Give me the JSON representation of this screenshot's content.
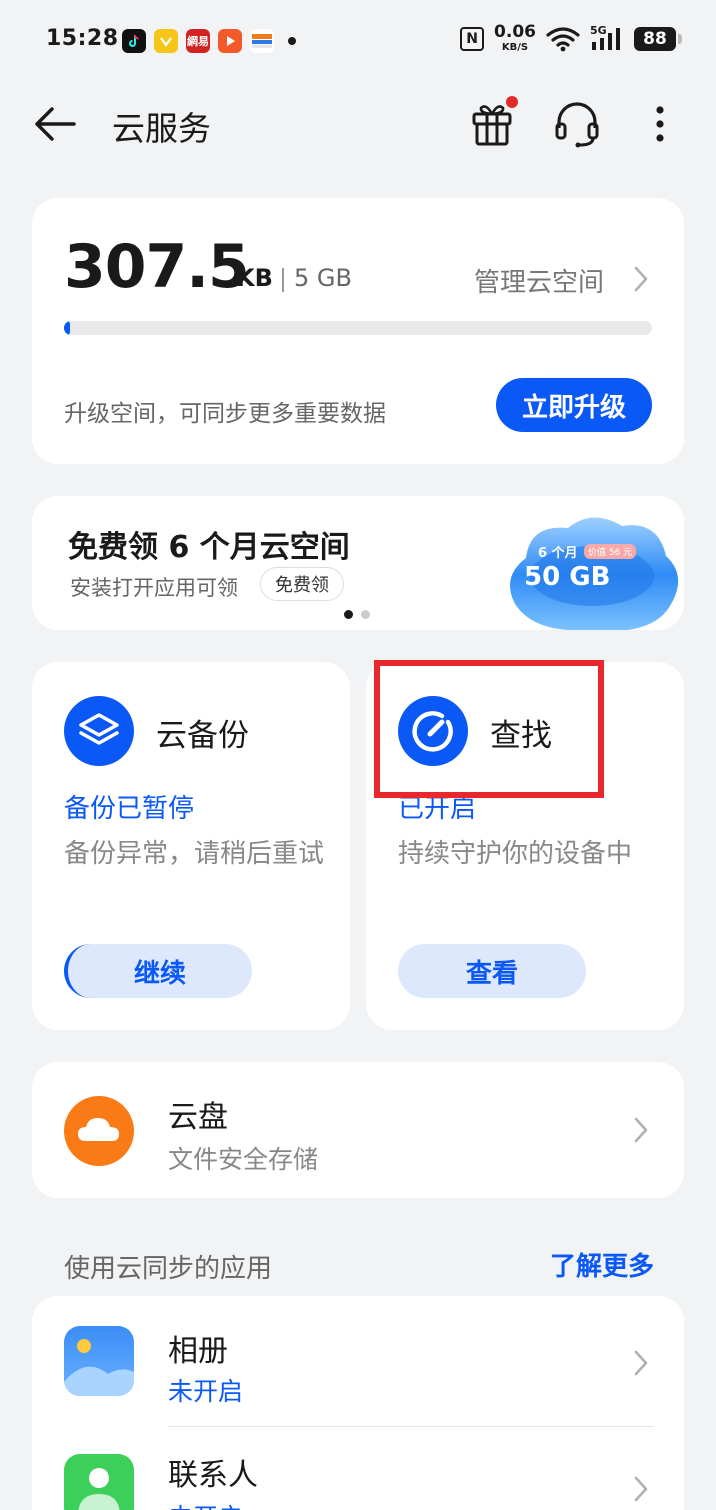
{
  "status_bar": {
    "time": "15:28",
    "app_icons": [
      "tiktok-icon",
      "lemon-icon",
      "netease-icon",
      "video-icon",
      "wallet-icon"
    ],
    "netease_label": "網易",
    "nfc_label": "N",
    "net_speed_value": "0.06",
    "net_speed_unit": "KB/S",
    "network_type": "5G",
    "battery_level": "88"
  },
  "header": {
    "title": "云服务"
  },
  "storage": {
    "used_value": "307.5",
    "used_unit": "KB",
    "total": "5 GB",
    "manage_label": "管理云空间",
    "usage_fraction": 0.01,
    "hint": "升级空间，可同步更多重要数据",
    "upgrade_button": "立即升级"
  },
  "promo": {
    "title": "免费领 6 个月云空间",
    "subtitle": "安装打开应用可领",
    "tag": "免费领",
    "art_months": "6 个月",
    "art_price": "价值 56 元",
    "art_size": "50 GB",
    "page_count": 2,
    "active_page": 1
  },
  "backup": {
    "name": "云备份",
    "status": "备份已暂停",
    "description": "备份异常，请稍后重试",
    "button": "继续"
  },
  "find": {
    "name": "查找",
    "status": "已开启",
    "description": "持续守护你的设备中",
    "button": "查看"
  },
  "drive": {
    "name": "云盘",
    "description": "文件安全存储"
  },
  "sync_section": {
    "title": "使用云同步的应用",
    "link": "了解更多"
  },
  "apps": [
    {
      "name": "相册",
      "status": "未开启"
    },
    {
      "name": "联系人",
      "status": "未开启"
    }
  ],
  "colors": {
    "accent": "#0a59f7",
    "drive": "#fa7a16",
    "highlight": "#e8282c",
    "background": "#f1f3f5"
  }
}
